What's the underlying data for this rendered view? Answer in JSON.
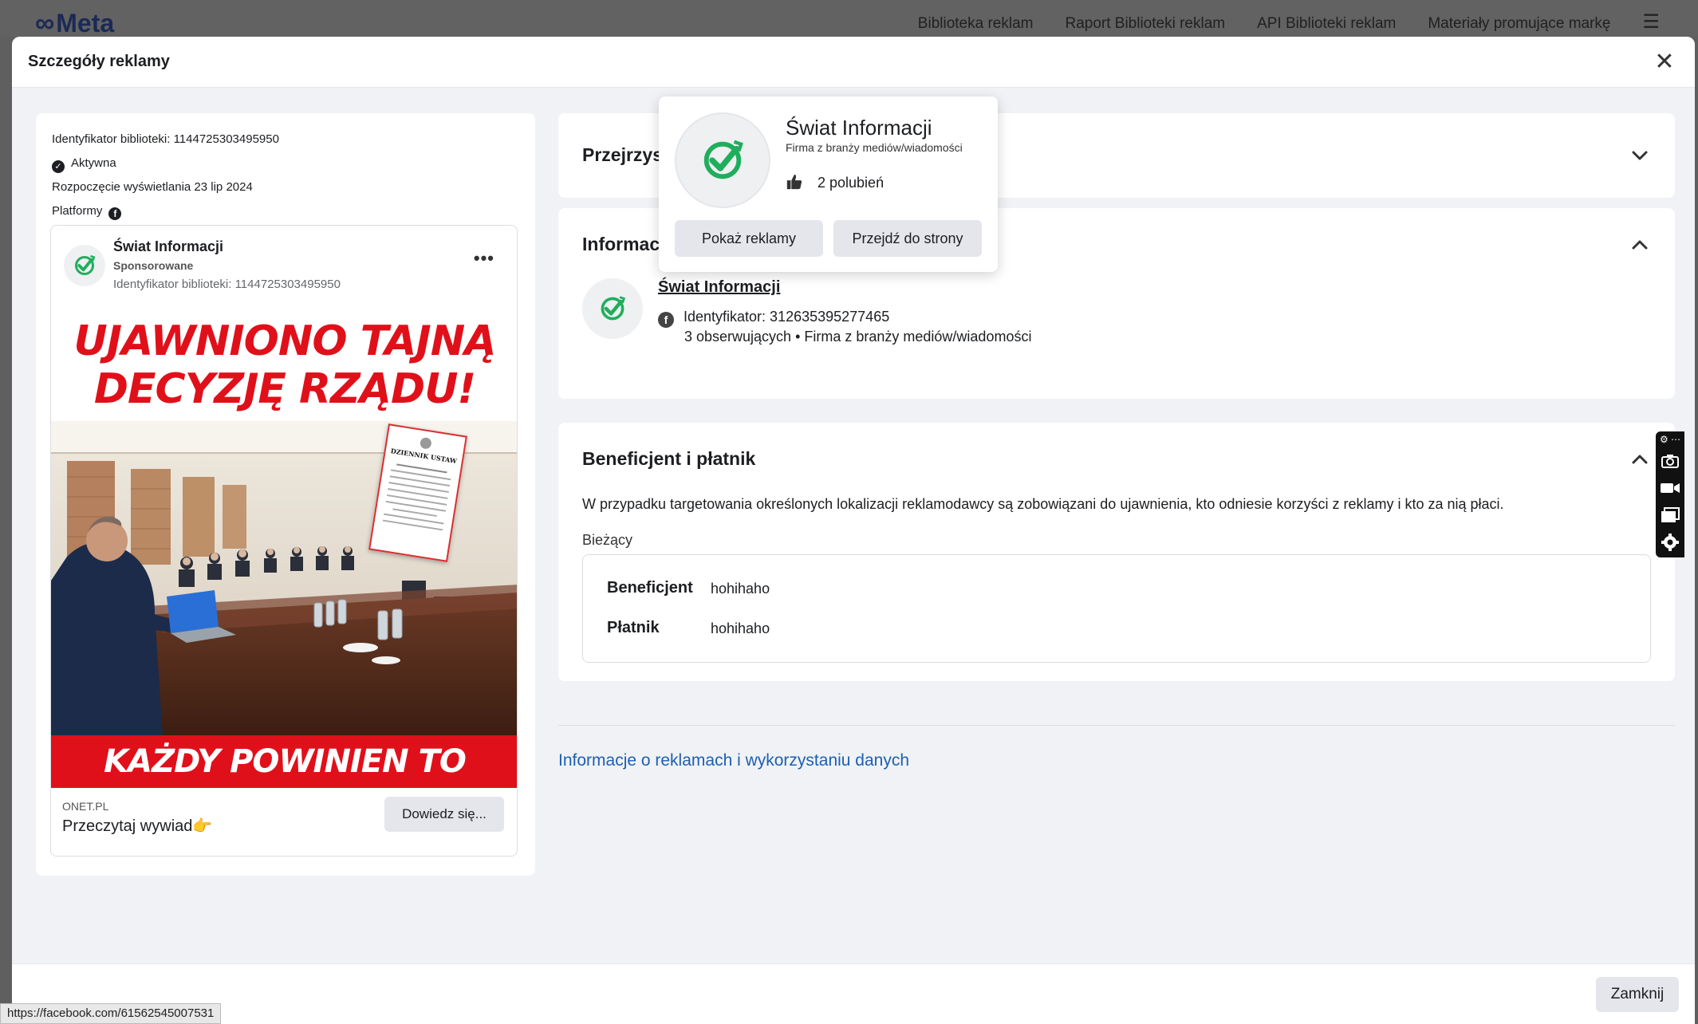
{
  "topnav": {
    "brand": "Meta",
    "links": [
      "Biblioteka reklam",
      "Raport Biblioteki reklam",
      "API Biblioteki reklam",
      "Materiały promujące markę"
    ]
  },
  "modal": {
    "title": "Szczegóły reklamy",
    "close_button": "Zamknij"
  },
  "ad_meta": {
    "library_id_line": "Identyfikator biblioteki: 1144725303495950",
    "status": "Aktywna",
    "started_line": "Rozpoczęcie wyświetlania 23 lip 2024",
    "platforms_label": "Platformy"
  },
  "ad_preview": {
    "page_name": "Świat Informacji",
    "sponsored": "Sponsorowane",
    "library_id": "Identyfikator biblioteki: 1144725303495950",
    "headline_line1": "UJAWNIONO TAJNĄ",
    "headline_line2": "DECYZJĘ RZĄDU!",
    "bottom_banner": "KAŻDY POWINIEN TO WIEDZIEĆ",
    "document_title": "DZIENNIK USTAW",
    "domain": "ONET.PL",
    "cta_text": "Przeczytaj wywiad👉",
    "cta_button": "Dowiedz się..."
  },
  "sections": {
    "transparency": {
      "title": "Przejrzystość"
    },
    "advertiser": {
      "title": "Informacje o reklamodawcy",
      "name": "Świat Informacji",
      "id_line": "Identyfikator: 312635395277465",
      "meta_line": "3 obserwujących • Firma z branży mediów/wiadomości"
    },
    "beneficiary": {
      "title": "Beneficjent i płatnik",
      "description": "W przypadku targetowania określonych lokalizacji reklamodawcy są zobowiązani do ujawnienia, kto odniesie korzyści z reklamy i kto za nią płaci.",
      "current_label": "Bieżący",
      "beneficiary_label": "Beneficjent",
      "beneficiary_value": "hohihaho",
      "payer_label": "Płatnik",
      "payer_value": "hohihaho"
    }
  },
  "info_link": "Informacje o reklamach i wykorzystaniu danych",
  "popover": {
    "name": "Świat Informacji",
    "category": "Firma z branży mediów/wiadomości",
    "likes": "2 polubień",
    "show_ads_button": "Pokaż reklamy",
    "go_to_page_button": "Przejdź do strony"
  },
  "status_url": "https://facebook.com/61562545007531",
  "colors": {
    "accent_red": "#e0101a",
    "logo_green": "#1fae5b",
    "link_blue": "#1d5fb3"
  }
}
